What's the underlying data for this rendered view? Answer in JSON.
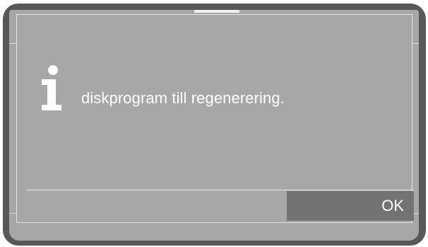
{
  "dialog": {
    "icon": "info-icon",
    "message": "diskprogram till regenerering.",
    "ok_label": "OK"
  },
  "colors": {
    "device_frame": "#585858",
    "screen_background": "#a7a7a7",
    "button_background": "#737373",
    "text": "#ffffff"
  }
}
